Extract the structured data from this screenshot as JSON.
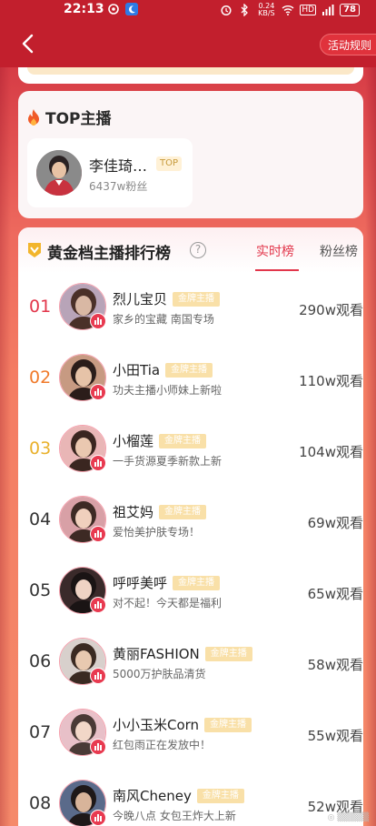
{
  "status_bar": {
    "time": "22:13",
    "net_speed": "0.24 KB/S",
    "network": "HD",
    "battery": "78"
  },
  "nav": {
    "back_icon": "chevron-left-icon",
    "rules_label": "活动规则"
  },
  "top_section": {
    "title": "TOP主播",
    "anchor": {
      "name": "李佳琦…",
      "badge": "TOP",
      "fans": "6437w粉丝"
    }
  },
  "ranking": {
    "title": "黄金档主播排行榜",
    "help_icon": "question-circle-icon",
    "tabs": [
      {
        "label": "实时榜",
        "active": true
      },
      {
        "label": "粉丝榜",
        "active": false
      }
    ],
    "rows": [
      {
        "rank": "01",
        "name": "烈儿宝贝",
        "badge": "金牌主播",
        "desc": "家乡的宝藏 南国专场",
        "views": "290w观看",
        "rank_color": "#e2364b"
      },
      {
        "rank": "02",
        "name": "小田Tia",
        "badge": "金牌主播",
        "desc": "功夫主播小师妹上新啦",
        "views": "110w观看",
        "rank_color": "#f07a2a"
      },
      {
        "rank": "03",
        "name": "小榴莲",
        "badge": "金牌主播",
        "desc": "一手货源夏季新款上新",
        "views": "104w观看",
        "rank_color": "#e9b12c"
      },
      {
        "rank": "04",
        "name": "祖艾妈",
        "badge": "金牌主播",
        "desc": "爱怡美护肤专场！",
        "views": "69w观看",
        "rank_color": "#333333"
      },
      {
        "rank": "05",
        "name": "呼呼美呼",
        "badge": "金牌主播",
        "desc": "对不起！今天都是福利",
        "views": "65w观看",
        "rank_color": "#333333"
      },
      {
        "rank": "06",
        "name": "黄丽FASHION",
        "badge": "金牌主播",
        "desc": "5000万护肤品清货",
        "views": "58w观看",
        "rank_color": "#333333"
      },
      {
        "rank": "07",
        "name": "小小玉米Corn",
        "badge": "金牌主播",
        "desc": "红包雨正在发放中！",
        "views": "55w观看",
        "rank_color": "#333333"
      },
      {
        "rank": "08",
        "name": "南风Cheney",
        "badge": "金牌主播",
        "desc": "今晚八点 女包王炸大上新",
        "views": "52w观看",
        "rank_color": "#333333"
      }
    ]
  },
  "colors": {
    "header_red": "#c21f2d",
    "accent_red": "#e2364b",
    "gold_badge": "#f9e0a8"
  }
}
